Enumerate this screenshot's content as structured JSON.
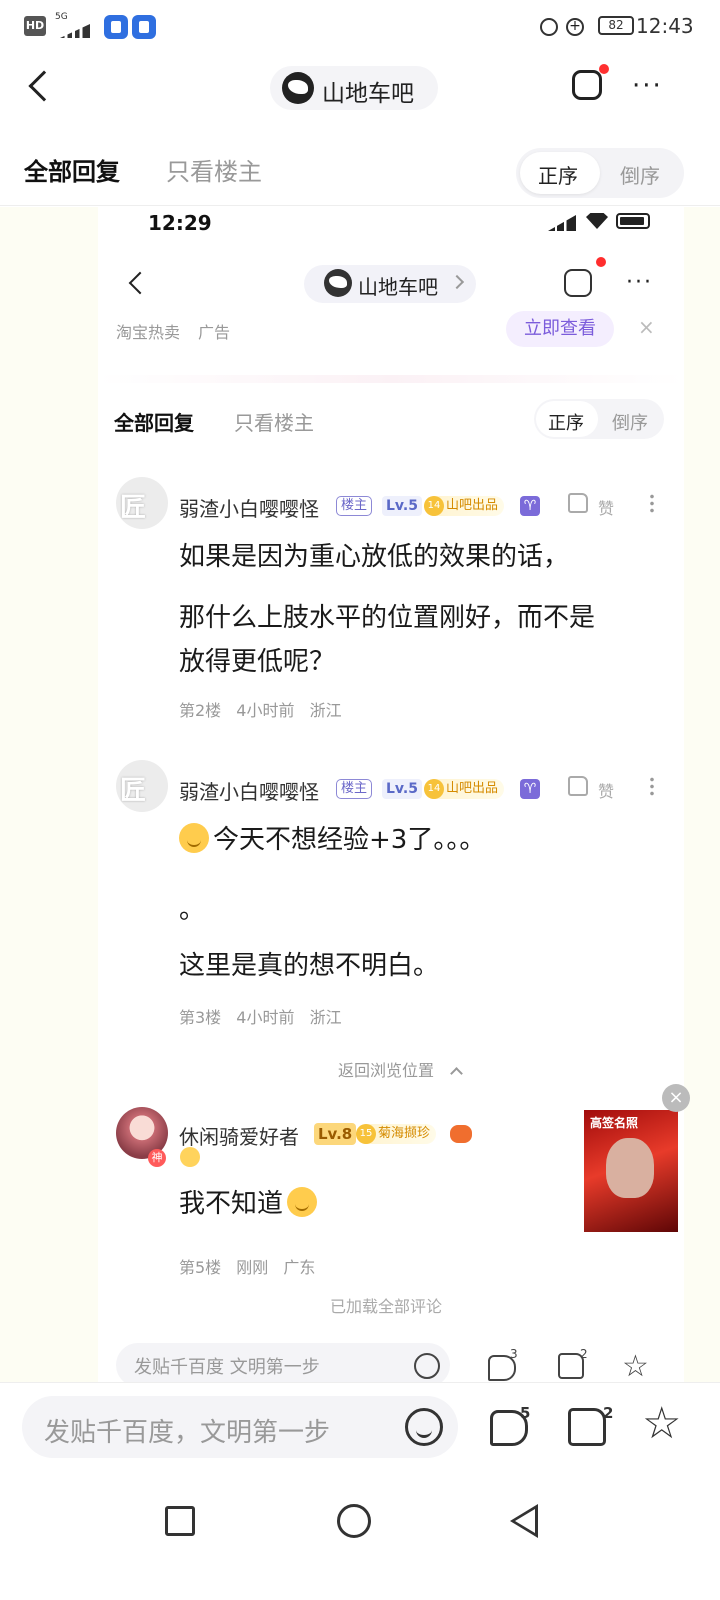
{
  "status_bar": {
    "hd": "HD",
    "network": "5G",
    "battery": "82",
    "time": "12:43"
  },
  "header": {
    "forum_name": "山地车吧"
  },
  "tabs": {
    "all_replies": "全部回复",
    "op_only": "只看楼主",
    "order_asc": "正序",
    "order_desc": "倒序"
  },
  "inner": {
    "status_time": "12:29",
    "forum_name": "山地车吧",
    "ad": {
      "source": "淘宝热卖",
      "label": "广告",
      "button": "立即查看",
      "close": "×"
    },
    "tabs": {
      "all_replies": "全部回复",
      "op_only": "只看楼主",
      "order_asc": "正序",
      "order_desc": "倒序"
    },
    "posts": [
      {
        "avatar_text": "匠",
        "username": "弱渣小白嘤嘤怪",
        "op_tag": "楼主",
        "level": "Lv.5",
        "badge_num": "14",
        "badge_label": "山吧出品",
        "zodiac": "♈",
        "like_label": "赞",
        "lines": [
          "如果是因为重心放低的效果的话，",
          "那什么上肢水平的位置刚好，而不是",
          "放得更低呢？"
        ],
        "floor": "第2楼",
        "time": "4小时前",
        "location": "浙江"
      },
      {
        "avatar_text": "匠",
        "username": "弱渣小白嘤嘤怪",
        "op_tag": "楼主",
        "level": "Lv.5",
        "badge_num": "14",
        "badge_label": "山吧出品",
        "zodiac": "♈",
        "like_label": "赞",
        "lines": [
          "今天不想经验+3了。。。",
          "。",
          "这里是真的想不明白。"
        ],
        "floor": "第3楼",
        "time": "4小时前",
        "location": "浙江"
      },
      {
        "avatar_badge": "神",
        "username": "休闲骑爱好者",
        "level": "Lv.8",
        "badge_num": "15",
        "badge_label": "菊海撷珍",
        "lines": [
          "我不知道"
        ],
        "floor": "第5楼",
        "time": "刚刚",
        "location": "广东"
      }
    ],
    "return_position": "返回浏览位置",
    "loaded_all": "已加载全部评论",
    "input_bar": {
      "placeholder": "发贴千百度 文明第一步",
      "reply_count": "3",
      "like_count": "2"
    }
  },
  "float_ad": {
    "title": "高签名照",
    "close": "×"
  },
  "bottom_bar": {
    "placeholder": "发贴千百度，文明第一步",
    "reply_count": "5",
    "like_count": "2"
  }
}
